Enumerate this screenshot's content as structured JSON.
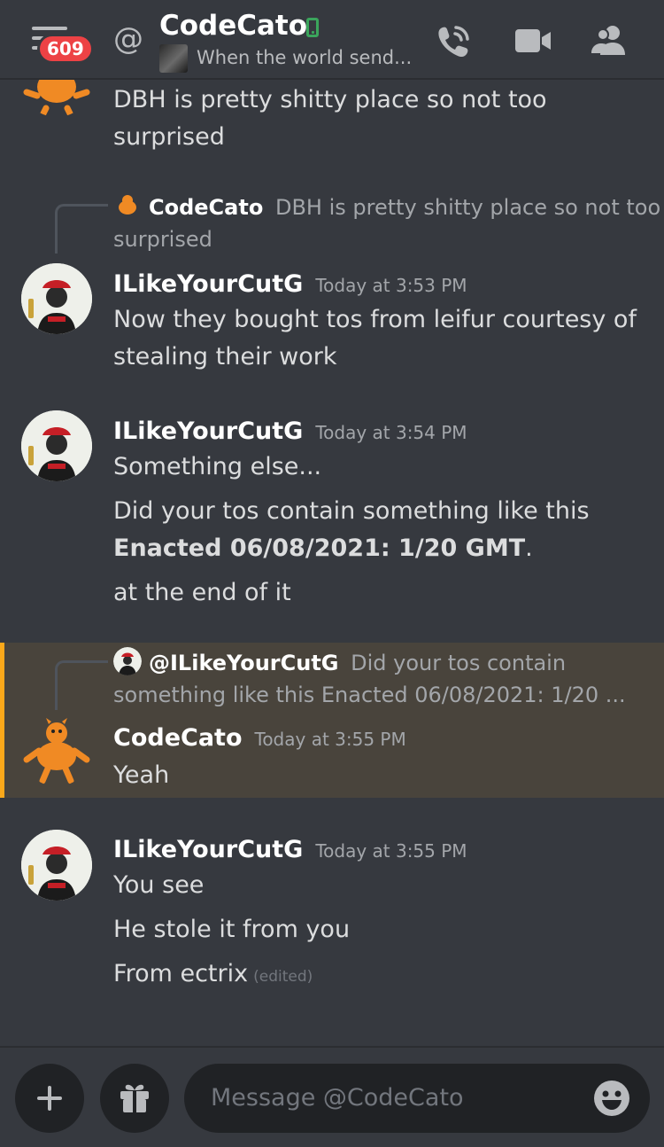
{
  "header": {
    "unread_badge": "609",
    "channel_prefix": "@",
    "title": "CodeCato",
    "status_text": "When the world send...",
    "icons": [
      "hamburger-icon",
      "mobile-status-icon",
      "call-icon",
      "video-icon",
      "members-icon"
    ]
  },
  "messages": [
    {
      "author": "",
      "time": "",
      "lines": [
        "DBH is pretty shitty place so not too",
        "surprised"
      ]
    },
    {
      "reply": {
        "name": "CodeCato",
        "line1": "DBH is pretty shitty place so not too",
        "line2": "surprised"
      },
      "author": "ILikeYourCutG",
      "time": "Today at 3:53 PM",
      "lines": [
        "Now they bought tos from leifur courtesy of",
        "stealing their work"
      ]
    },
    {
      "author": "ILikeYourCutG",
      "time": "Today at 3:54 PM",
      "lines": [
        "Something else...",
        "Did your tos contain something like this",
        "Enacted 06/08/2021: 1/20 GMT",
        ".",
        "at the end of it"
      ]
    },
    {
      "reply": {
        "name": "@ILikeYourCutG",
        "line1": "Did your tos contain",
        "line2": "something like this  Enacted 06/08/2021: 1/20 ..."
      },
      "author": "CodeCato",
      "time": "Today at 3:55 PM",
      "lines": [
        "Yeah"
      ]
    },
    {
      "author": "ILikeYourCutG",
      "time": "Today at 3:55 PM",
      "lines": [
        "You see",
        "He stole it from you",
        "From ectrix"
      ],
      "edited": "(edited)"
    }
  ],
  "composer": {
    "placeholder": "Message @CodeCato",
    "icons": [
      "plus-icon",
      "gift-icon",
      "emoji-icon"
    ]
  },
  "colors": {
    "background": "#36393f",
    "mention_highlight": "#49443c",
    "mention_bar": "#faa81a",
    "online_mobile": "#3ba55c",
    "badge": "#ed4245"
  }
}
